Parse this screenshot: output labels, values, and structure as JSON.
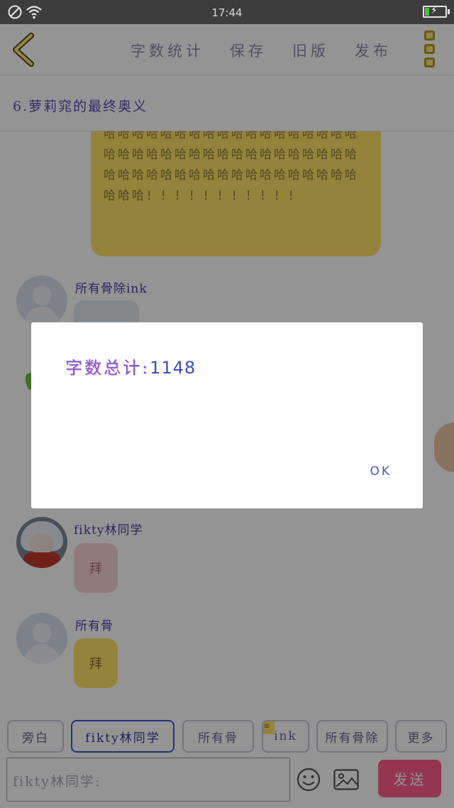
{
  "status_bar": {
    "time": "17:44",
    "icons": [
      "dnd-icon",
      "wifi-icon",
      "battery-charging-icon"
    ]
  },
  "toolbar": {
    "back_icon": "chevron-left-icon",
    "actions": [
      {
        "label": "字数统计"
      },
      {
        "label": "保存"
      },
      {
        "label": "旧版"
      },
      {
        "label": "发布"
      }
    ],
    "menu_icon": "more-icon",
    "accent": "#f6e58a"
  },
  "chapter": {
    "title": "6.萝莉窕的最终奥义"
  },
  "chat": {
    "first_message_text": "哈哈哈哈哈哈哈哈哈哈哈哈哈哈哈哈哈哈哈哈哈哈哈哈哈哈哈哈哈哈哈哈哈哈哈哈哈哈哈哈哈哈哈哈哈哈哈哈哈哈哈哈哈哈哈哈哈！！！！！！！！！！！",
    "messages": [
      {
        "sender": "所有骨除ink",
        "text": ""
      },
      {
        "sender": "fikty林同学",
        "text": "拜"
      },
      {
        "sender": "所有骨",
        "text": "拜"
      }
    ]
  },
  "mentions": {
    "items": [
      {
        "label": "旁白"
      },
      {
        "label": "fikty林同学"
      },
      {
        "label": "所有骨"
      },
      {
        "label": "ink"
      },
      {
        "label": "所有骨除"
      },
      {
        "label": "更多"
      }
    ]
  },
  "input": {
    "value": "fikty林同学:",
    "emoji_icon": "emoji-icon",
    "image_icon": "image-icon",
    "send_label": "发送",
    "send_color": "#ff5d8a"
  },
  "dialog": {
    "label": "字数总计:",
    "value": "1148",
    "ok_label": "OK"
  }
}
